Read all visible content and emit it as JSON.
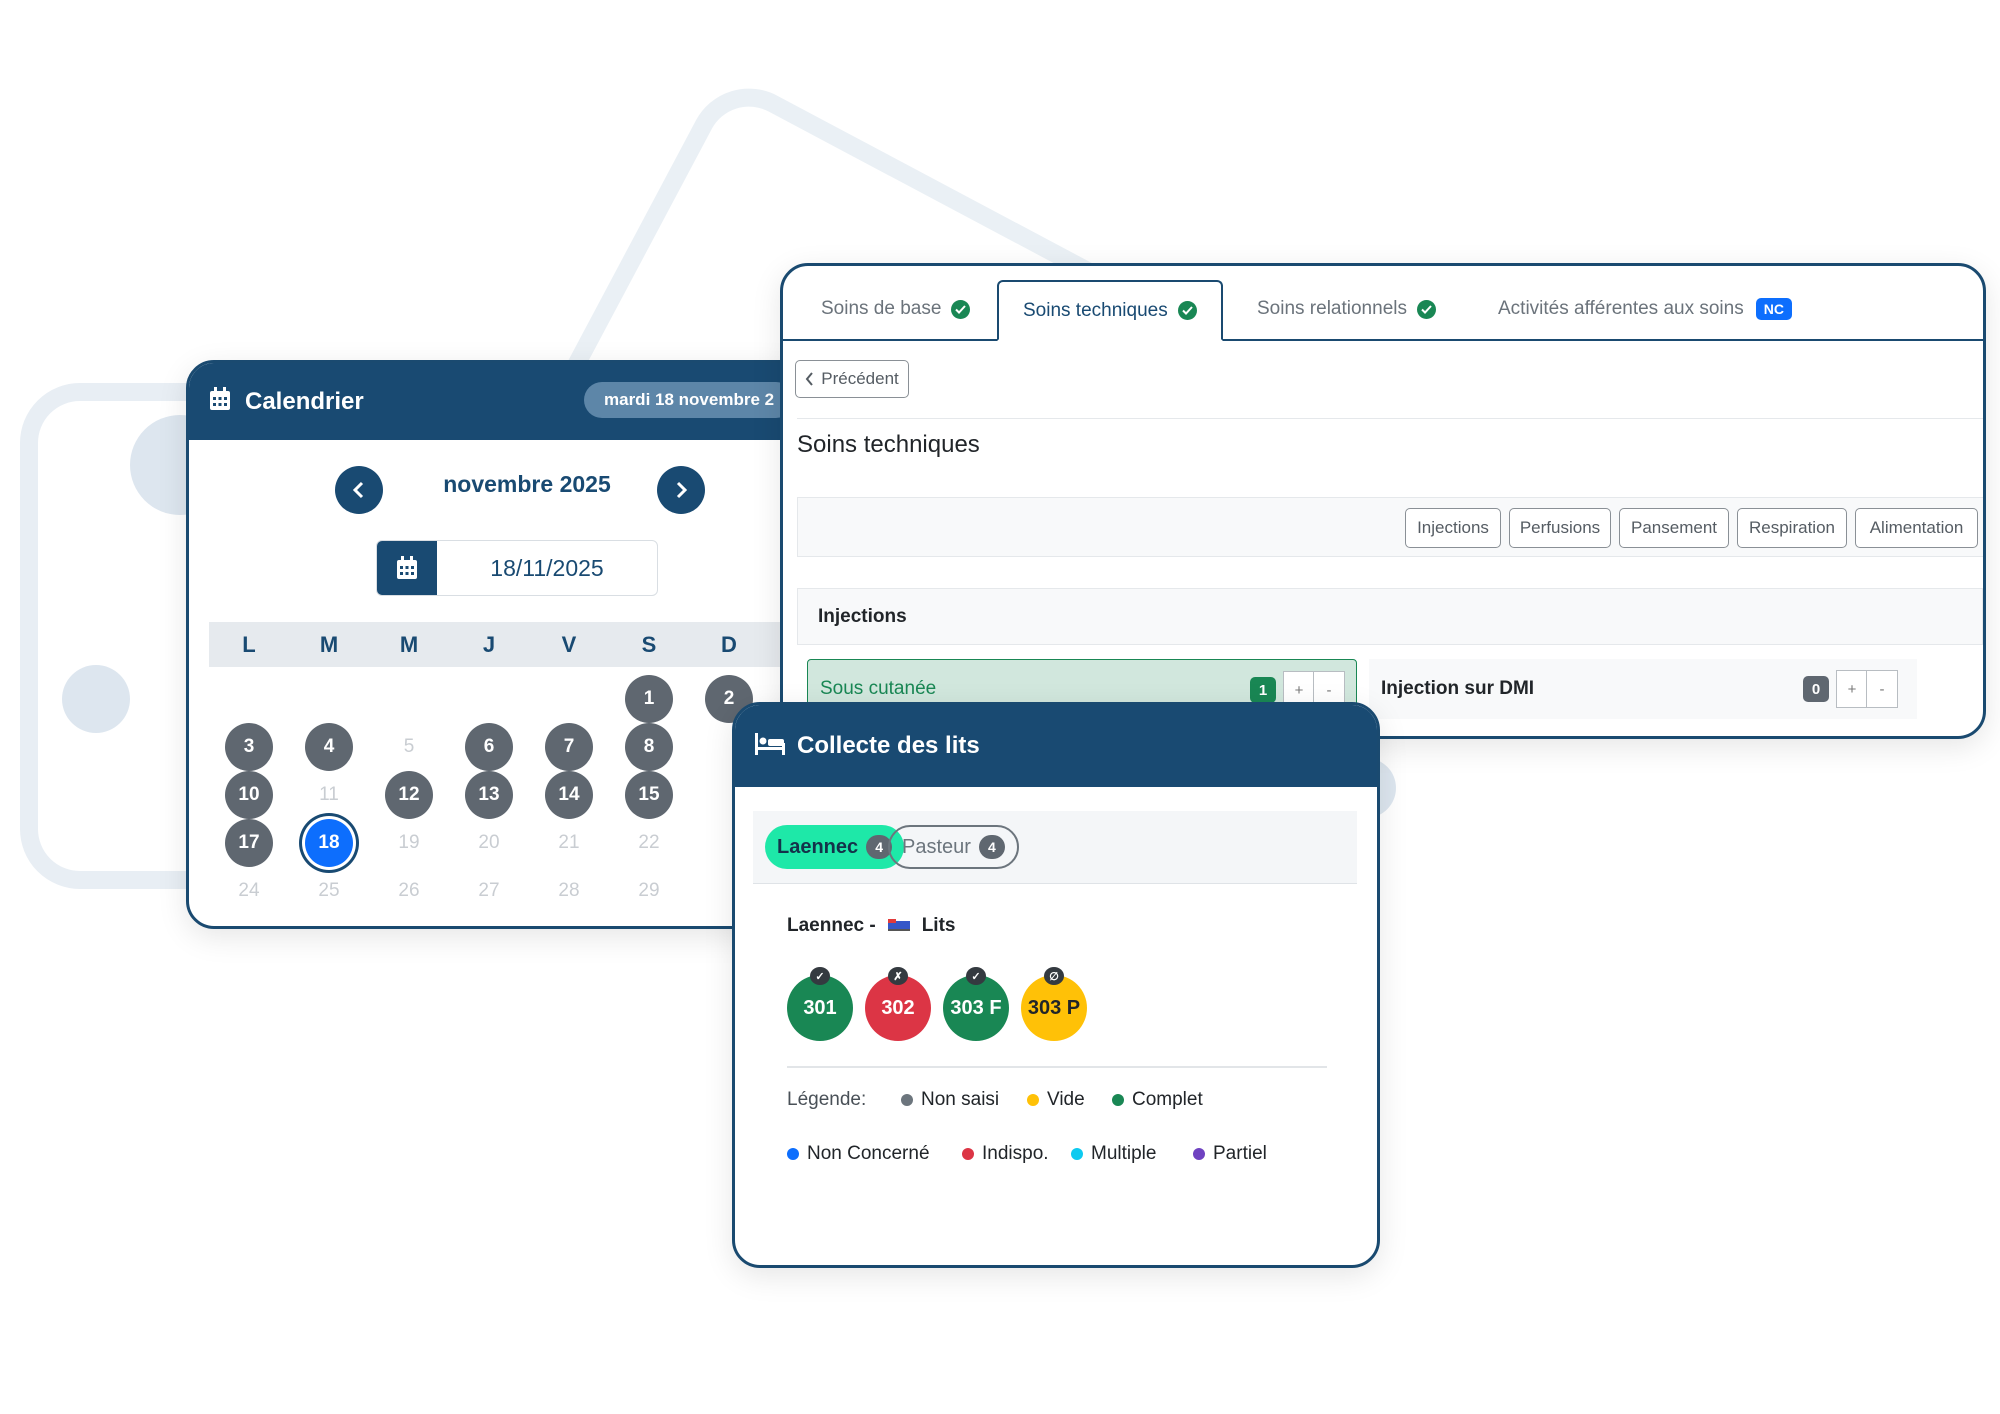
{
  "calendar": {
    "title": "Calendrier",
    "date_pill": "mardi 18 novembre 2",
    "month": "novembre 2025",
    "date_value": "18/11/2025",
    "weekdays": [
      "L",
      "M",
      "M",
      "J",
      "V",
      "S",
      "D"
    ],
    "days": [
      {
        "n": "1",
        "s": "f"
      },
      {
        "n": "2",
        "s": "f"
      },
      {
        "n": "3",
        "s": "f"
      },
      {
        "n": "4",
        "s": "f"
      },
      {
        "n": "5",
        "s": "m"
      },
      {
        "n": "6",
        "s": "f"
      },
      {
        "n": "7",
        "s": "f"
      },
      {
        "n": "8",
        "s": "f"
      },
      {
        "n": "10",
        "s": "f"
      },
      {
        "n": "11",
        "s": "m"
      },
      {
        "n": "12",
        "s": "f"
      },
      {
        "n": "13",
        "s": "f"
      },
      {
        "n": "14",
        "s": "f"
      },
      {
        "n": "15",
        "s": "f"
      },
      {
        "n": "17",
        "s": "f"
      },
      {
        "n": "18",
        "s": "s"
      },
      {
        "n": "19",
        "s": "m"
      },
      {
        "n": "20",
        "s": "m"
      },
      {
        "n": "21",
        "s": "m"
      },
      {
        "n": "22",
        "s": "m"
      },
      {
        "n": "24",
        "s": "m"
      },
      {
        "n": "25",
        "s": "m"
      },
      {
        "n": "26",
        "s": "m"
      },
      {
        "n": "27",
        "s": "m"
      },
      {
        "n": "28",
        "s": "m"
      },
      {
        "n": "29",
        "s": "m"
      }
    ]
  },
  "soins": {
    "tabs": [
      {
        "label": "Soins de base",
        "status": "check"
      },
      {
        "label": "Soins techniques",
        "status": "check",
        "active": true
      },
      {
        "label": "Soins relationnels",
        "status": "check"
      },
      {
        "label": "Activités afférentes aux soins",
        "status": "NC"
      }
    ],
    "back_label": "Précédent",
    "title": "Soins techniques",
    "filters": [
      "Injections",
      "Perfusions",
      "Pansement",
      "Respiration",
      "Alimentation"
    ],
    "section_title": "Injections",
    "items": [
      {
        "label": "Sous cutanée",
        "count": "1",
        "color": "#198754"
      },
      {
        "label": "Injection sur DMI",
        "count": "0",
        "color": "#5f6770"
      }
    ],
    "plus": "+",
    "minus": "-"
  },
  "lits": {
    "title": "Collecte des lits",
    "wards": [
      {
        "name": "Laennec",
        "count": "4",
        "active": true
      },
      {
        "name": "Pasteur",
        "count": "4"
      }
    ],
    "bed_title_prefix": "Laennec -",
    "bed_title_suffix": "Lits",
    "beds": [
      {
        "label": "301",
        "color": "#198754",
        "mark": "✓",
        "text": "#ffffff"
      },
      {
        "label": "302",
        "color": "#dc3545",
        "mark": "✗",
        "text": "#ffffff"
      },
      {
        "label": "303 F",
        "color": "#198754",
        "mark": "✓",
        "text": "#ffffff"
      },
      {
        "label": "303 P",
        "color": "#ffc107",
        "mark": "∅",
        "text": "#212529"
      }
    ],
    "legend_label": "Légende:",
    "legend": [
      {
        "label": "Non saisi",
        "color": "#6c757d"
      },
      {
        "label": "Vide",
        "color": "#ffc107"
      },
      {
        "label": "Complet",
        "color": "#198754"
      },
      {
        "label": "Non Concerné",
        "color": "#0d6efd"
      },
      {
        "label": "Indispo.",
        "color": "#dc3545"
      },
      {
        "label": "Multiple",
        "color": "#0dcaf0"
      },
      {
        "label": "Partiel",
        "color": "#6f42c1"
      }
    ]
  }
}
